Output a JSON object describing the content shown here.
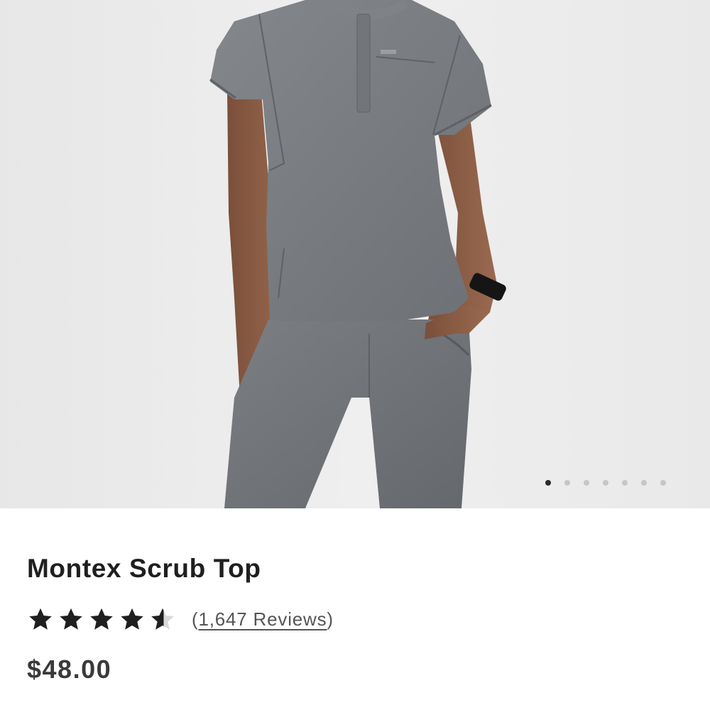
{
  "product": {
    "title": "Montex Scrub Top",
    "rating": 4.5,
    "rating_max": 5,
    "reviews_open": "(",
    "reviews_count": "1,647 Reviews",
    "reviews_close": ")",
    "price": "$48.00"
  },
  "gallery": {
    "image_count": 7,
    "active_index": 0,
    "image_subject": "model wearing grey scrub top and pants"
  },
  "icons": {
    "star": "star-icon",
    "half_star": "star-half-icon"
  },
  "colors": {
    "star": "#1f1f1f",
    "background_photo": "#ececec",
    "garment": "#777a7e",
    "dot_active": "#2a2a2a",
    "dot_inactive": "#c6c6c6"
  }
}
